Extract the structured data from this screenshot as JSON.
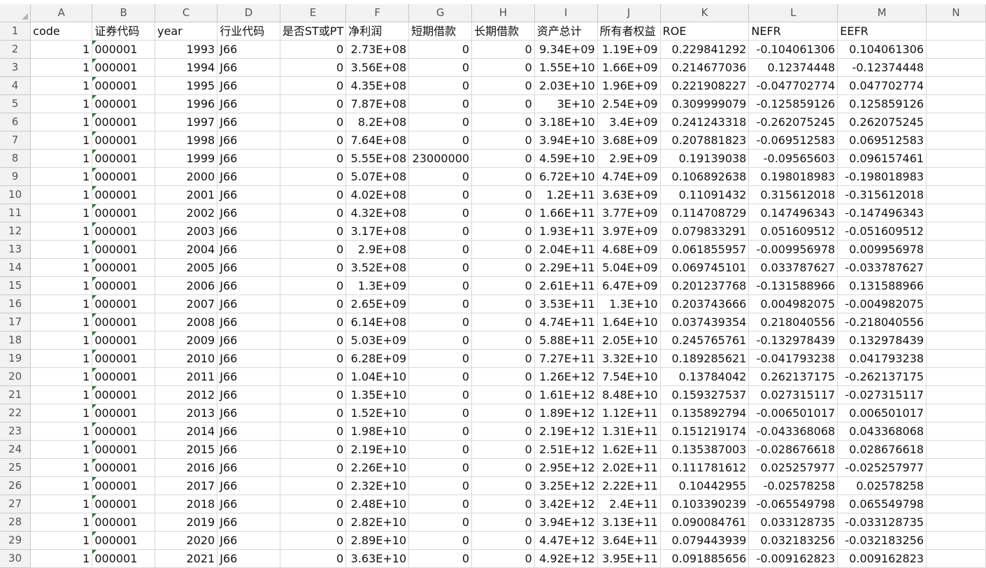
{
  "columns": [
    "A",
    "B",
    "C",
    "D",
    "E",
    "F",
    "G",
    "H",
    "I",
    "J",
    "K",
    "L",
    "M",
    "N"
  ],
  "rows": [
    [
      "1",
      "code",
      "证券代码",
      "year",
      "行业代码",
      "是否ST或PT",
      "净利润",
      "短期借款",
      "长期借款",
      "资产总计",
      "所有者权益",
      "ROE",
      "NEFR",
      "EEFR",
      ""
    ],
    [
      "2",
      "1",
      "000001",
      "1993",
      "J66",
      "0",
      "2.73E+08",
      "0",
      "0",
      "9.34E+09",
      "1.19E+09",
      "0.229841292",
      "-0.104061306",
      "0.104061306",
      ""
    ],
    [
      "3",
      "1",
      "000001",
      "1994",
      "J66",
      "0",
      "3.56E+08",
      "0",
      "0",
      "1.55E+10",
      "1.66E+09",
      "0.214677036",
      "0.12374448",
      "-0.12374448",
      ""
    ],
    [
      "4",
      "1",
      "000001",
      "1995",
      "J66",
      "0",
      "4.35E+08",
      "0",
      "0",
      "2.03E+10",
      "1.96E+09",
      "0.221908227",
      "-0.047702774",
      "0.047702774",
      ""
    ],
    [
      "5",
      "1",
      "000001",
      "1996",
      "J66",
      "0",
      "7.87E+08",
      "0",
      "0",
      "3E+10",
      "2.54E+09",
      "0.309999079",
      "-0.125859126",
      "0.125859126",
      ""
    ],
    [
      "6",
      "1",
      "000001",
      "1997",
      "J66",
      "0",
      "8.2E+08",
      "0",
      "0",
      "3.18E+10",
      "3.4E+09",
      "0.241243318",
      "-0.262075245",
      "0.262075245",
      ""
    ],
    [
      "7",
      "1",
      "000001",
      "1998",
      "J66",
      "0",
      "7.64E+08",
      "0",
      "0",
      "3.94E+10",
      "3.68E+09",
      "0.207881823",
      "-0.069512583",
      "0.069512583",
      ""
    ],
    [
      "8",
      "1",
      "000001",
      "1999",
      "J66",
      "0",
      "5.55E+08",
      "23000000",
      "0",
      "4.59E+10",
      "2.9E+09",
      "0.19139038",
      "-0.09565603",
      "0.096157461",
      ""
    ],
    [
      "9",
      "1",
      "000001",
      "2000",
      "J66",
      "0",
      "5.07E+08",
      "0",
      "0",
      "6.72E+10",
      "4.74E+09",
      "0.106892638",
      "0.198018983",
      "-0.198018983",
      ""
    ],
    [
      "10",
      "1",
      "000001",
      "2001",
      "J66",
      "0",
      "4.02E+08",
      "0",
      "0",
      "1.2E+11",
      "3.63E+09",
      "0.11091432",
      "0.315612018",
      "-0.315612018",
      ""
    ],
    [
      "11",
      "1",
      "000001",
      "2002",
      "J66",
      "0",
      "4.32E+08",
      "0",
      "0",
      "1.66E+11",
      "3.77E+09",
      "0.114708729",
      "0.147496343",
      "-0.147496343",
      ""
    ],
    [
      "12",
      "1",
      "000001",
      "2003",
      "J66",
      "0",
      "3.17E+08",
      "0",
      "0",
      "1.93E+11",
      "3.97E+09",
      "0.079833291",
      "0.051609512",
      "-0.051609512",
      ""
    ],
    [
      "13",
      "1",
      "000001",
      "2004",
      "J66",
      "0",
      "2.9E+08",
      "0",
      "0",
      "2.04E+11",
      "4.68E+09",
      "0.061855957",
      "-0.009956978",
      "0.009956978",
      ""
    ],
    [
      "14",
      "1",
      "000001",
      "2005",
      "J66",
      "0",
      "3.52E+08",
      "0",
      "0",
      "2.29E+11",
      "5.04E+09",
      "0.069745101",
      "0.033787627",
      "-0.033787627",
      ""
    ],
    [
      "15",
      "1",
      "000001",
      "2006",
      "J66",
      "0",
      "1.3E+09",
      "0",
      "0",
      "2.61E+11",
      "6.47E+09",
      "0.201237768",
      "-0.131588966",
      "0.131588966",
      ""
    ],
    [
      "16",
      "1",
      "000001",
      "2007",
      "J66",
      "0",
      "2.65E+09",
      "0",
      "0",
      "3.53E+11",
      "1.3E+10",
      "0.203743666",
      "0.004982075",
      "-0.004982075",
      ""
    ],
    [
      "17",
      "1",
      "000001",
      "2008",
      "J66",
      "0",
      "6.14E+08",
      "0",
      "0",
      "4.74E+11",
      "1.64E+10",
      "0.037439354",
      "0.218040556",
      "-0.218040556",
      ""
    ],
    [
      "18",
      "1",
      "000001",
      "2009",
      "J66",
      "0",
      "5.03E+09",
      "0",
      "0",
      "5.88E+11",
      "2.05E+10",
      "0.245765761",
      "-0.132978439",
      "0.132978439",
      ""
    ],
    [
      "19",
      "1",
      "000001",
      "2010",
      "J66",
      "0",
      "6.28E+09",
      "0",
      "0",
      "7.27E+11",
      "3.32E+10",
      "0.189285621",
      "-0.041793238",
      "0.041793238",
      ""
    ],
    [
      "20",
      "1",
      "000001",
      "2011",
      "J66",
      "0",
      "1.04E+10",
      "0",
      "0",
      "1.26E+12",
      "7.54E+10",
      "0.13784042",
      "0.262137175",
      "-0.262137175",
      ""
    ],
    [
      "21",
      "1",
      "000001",
      "2012",
      "J66",
      "0",
      "1.35E+10",
      "0",
      "0",
      "1.61E+12",
      "8.48E+10",
      "0.159327537",
      "0.027315117",
      "-0.027315117",
      ""
    ],
    [
      "22",
      "1",
      "000001",
      "2013",
      "J66",
      "0",
      "1.52E+10",
      "0",
      "0",
      "1.89E+12",
      "1.12E+11",
      "0.135892794",
      "-0.006501017",
      "0.006501017",
      ""
    ],
    [
      "23",
      "1",
      "000001",
      "2014",
      "J66",
      "0",
      "1.98E+10",
      "0",
      "0",
      "2.19E+12",
      "1.31E+11",
      "0.151219174",
      "-0.043368068",
      "0.043368068",
      ""
    ],
    [
      "24",
      "1",
      "000001",
      "2015",
      "J66",
      "0",
      "2.19E+10",
      "0",
      "0",
      "2.51E+12",
      "1.62E+11",
      "0.135387003",
      "-0.028676618",
      "0.028676618",
      ""
    ],
    [
      "25",
      "1",
      "000001",
      "2016",
      "J66",
      "0",
      "2.26E+10",
      "0",
      "0",
      "2.95E+12",
      "2.02E+11",
      "0.111781612",
      "0.025257977",
      "-0.025257977",
      ""
    ],
    [
      "26",
      "1",
      "000001",
      "2017",
      "J66",
      "0",
      "2.32E+10",
      "0",
      "0",
      "3.25E+12",
      "2.22E+11",
      "0.10442955",
      "-0.02578258",
      "0.02578258",
      ""
    ],
    [
      "27",
      "1",
      "000001",
      "2018",
      "J66",
      "0",
      "2.48E+10",
      "0",
      "0",
      "3.42E+12",
      "2.4E+11",
      "0.103390239",
      "-0.065549798",
      "0.065549798",
      ""
    ],
    [
      "28",
      "1",
      "000001",
      "2019",
      "J66",
      "0",
      "2.82E+10",
      "0",
      "0",
      "3.94E+12",
      "3.13E+11",
      "0.090084761",
      "0.033128735",
      "-0.033128735",
      ""
    ],
    [
      "29",
      "1",
      "000001",
      "2020",
      "J66",
      "0",
      "2.89E+10",
      "0",
      "0",
      "4.47E+12",
      "3.64E+11",
      "0.079443939",
      "0.032183256",
      "-0.032183256",
      ""
    ],
    [
      "30",
      "1",
      "000001",
      "2021",
      "J66",
      "0",
      "3.63E+10",
      "0",
      "0",
      "4.92E+12",
      "3.95E+11",
      "0.091885656",
      "-0.009162823",
      "0.009162823",
      ""
    ]
  ]
}
